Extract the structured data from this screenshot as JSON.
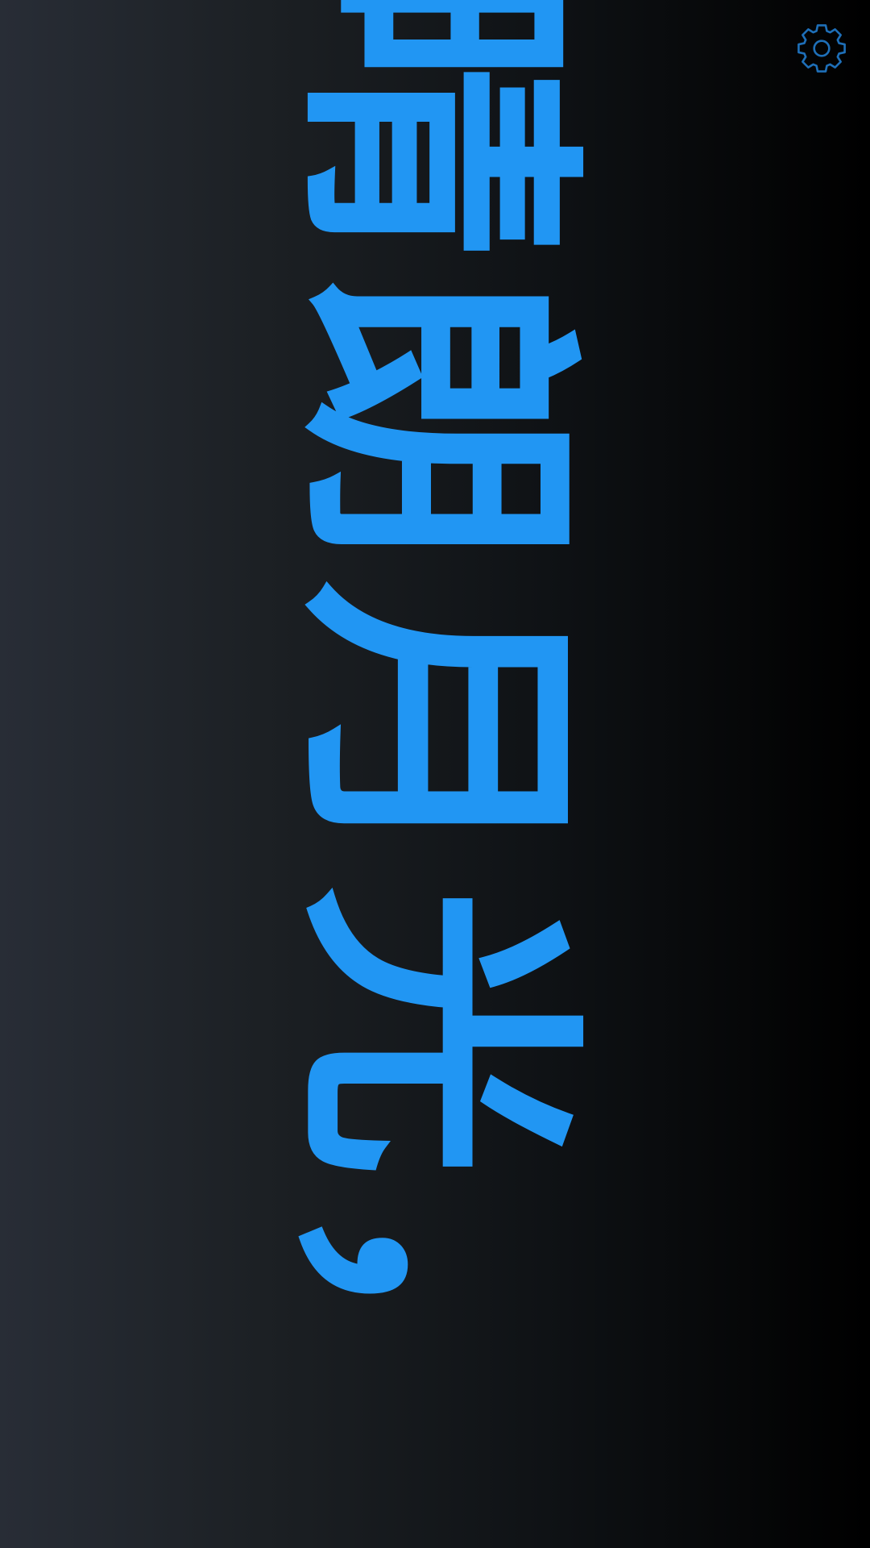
{
  "display": {
    "scroll_text": "晴朗月光，",
    "text_color": "#2196f3",
    "background_gradient": [
      "#282d36",
      "#1c2024",
      "#0e1114",
      "#000000"
    ],
    "orientation": "rotated-90-clockwise"
  },
  "settings": {
    "icon": "gear-icon",
    "color": "#1e6fb8"
  }
}
